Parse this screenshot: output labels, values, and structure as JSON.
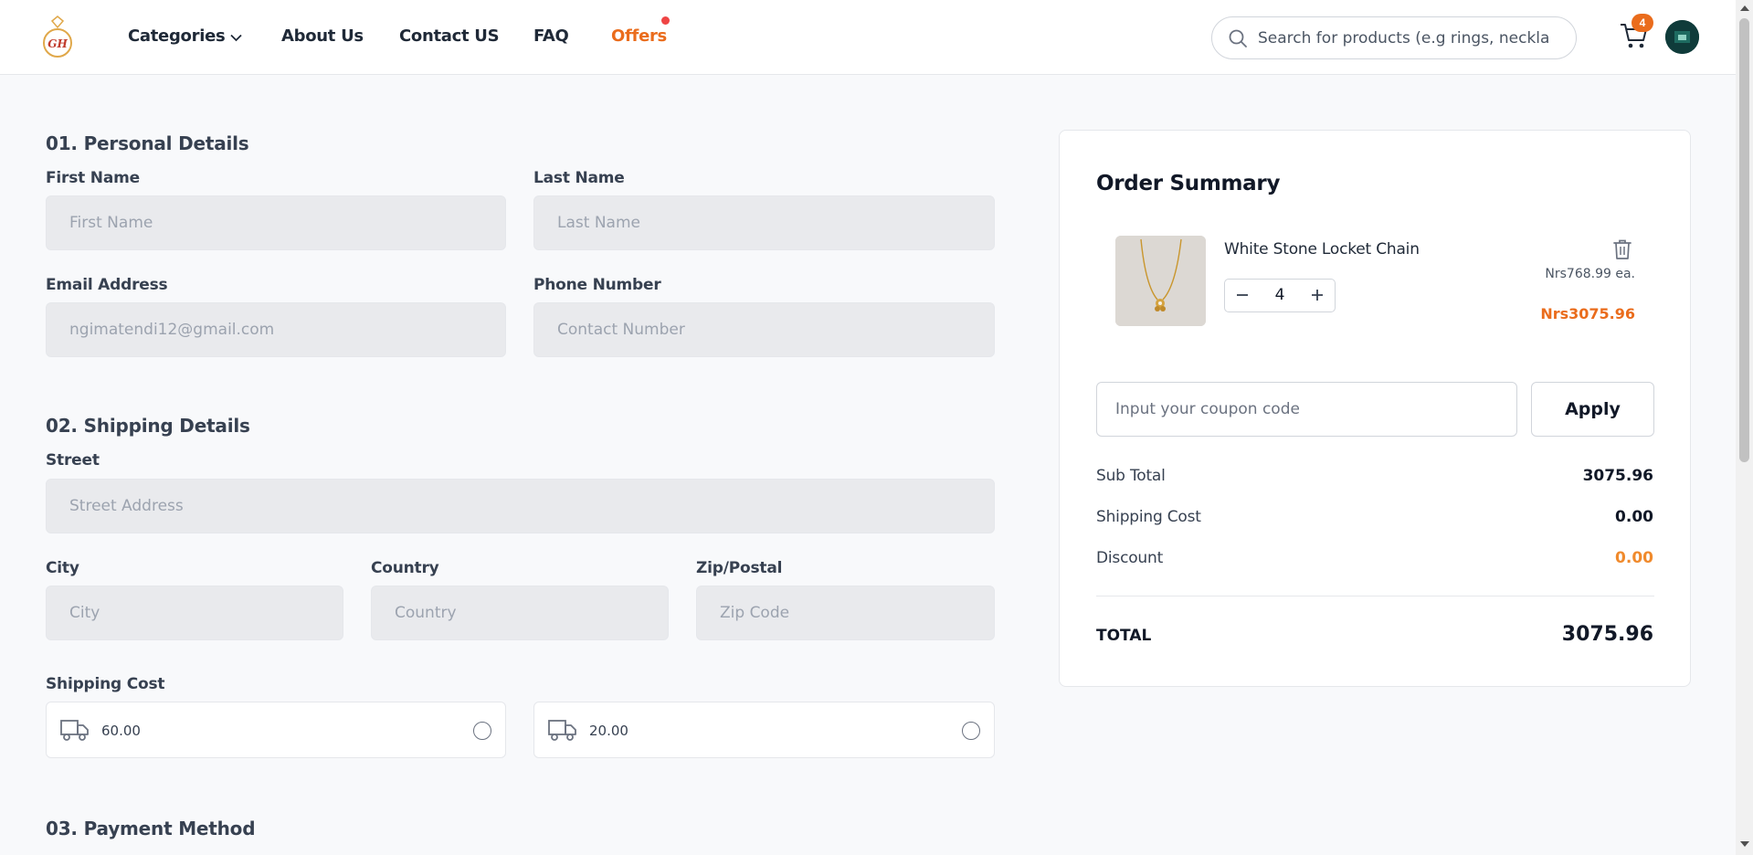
{
  "header": {
    "logo_text": "GH",
    "nav": {
      "categories": "Categories",
      "about": "About Us",
      "contact": "Contact US",
      "faq": "FAQ",
      "offers": "Offers"
    },
    "search_placeholder": "Search for products (e.g rings, neckla",
    "cart_count": "4"
  },
  "personal": {
    "title": "01. Personal Details",
    "first_name_label": "First Name",
    "first_name_placeholder": "First Name",
    "last_name_label": "Last Name",
    "last_name_placeholder": "Last Name",
    "email_label": "Email Address",
    "email_placeholder": "ngimatendi12@gmail.com",
    "phone_label": "Phone Number",
    "phone_placeholder": "Contact Number"
  },
  "shipping": {
    "title": "02. Shipping Details",
    "street_label": "Street",
    "street_placeholder": "Street Address",
    "city_label": "City",
    "city_placeholder": "City",
    "country_label": "Country",
    "country_placeholder": "Country",
    "zip_label": "Zip/Postal",
    "zip_placeholder": "Zip Code",
    "cost_label": "Shipping Cost",
    "options": [
      {
        "value": "60.00"
      },
      {
        "value": "20.00"
      }
    ]
  },
  "payment": {
    "title": "03. Payment Method"
  },
  "summary": {
    "title": "Order Summary",
    "item": {
      "name": "White Stone Locket Chain",
      "unit_price": "Nrs768.99 ea.",
      "line_total": "Nrs3075.96",
      "quantity": "4"
    },
    "coupon_placeholder": "Input your coupon code",
    "apply_label": "Apply",
    "subtotal_label": "Sub Total",
    "subtotal_value": "3075.96",
    "shipping_label": "Shipping Cost",
    "shipping_value": "0.00",
    "discount_label": "Discount",
    "discount_value": "0.00",
    "total_label": "TOTAL",
    "total_value": "3075.96"
  },
  "colors": {
    "accent": "#ea6c1c",
    "field_bg": "#e9eaed",
    "page_bg": "#f8f9fb"
  }
}
